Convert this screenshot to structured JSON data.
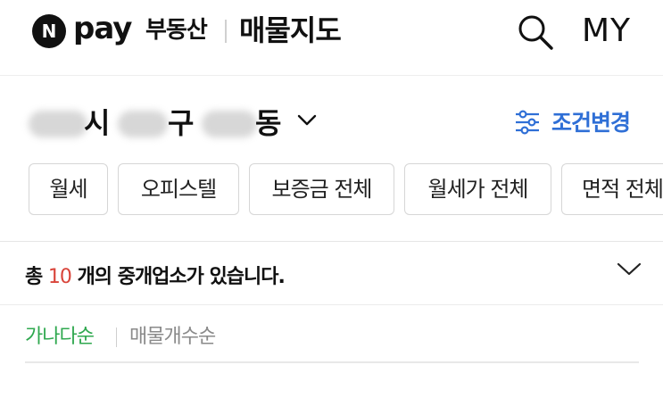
{
  "header": {
    "logo_letter": "N",
    "brand_pay": "pay",
    "brand_sub": "부동산",
    "page_title": "매물지도",
    "my_label": "MY",
    "icons": {
      "search": "search-icon",
      "logo": "naver-n-logo-icon"
    }
  },
  "location": {
    "city_suffix": "시",
    "district_suffix": "구",
    "dong_suffix": "동",
    "chevron_icon": "chevron-down-icon"
  },
  "filter": {
    "label": "조건변경",
    "icon": "sliders-icon",
    "accent": "#2f6fd6"
  },
  "chips": [
    {
      "label": "월세"
    },
    {
      "label": "오피스텔"
    },
    {
      "label": "보증금 전체"
    },
    {
      "label": "월세가 전체"
    },
    {
      "label": "면적 전체"
    }
  ],
  "summary": {
    "prefix": "총 ",
    "count": "10",
    "suffix": " 개의 중개업소가 있습니다.",
    "count_color": "#d9443a"
  },
  "sort": {
    "option_a": "가나다순",
    "option_b": "매물개수순",
    "active_color": "#2fa84f",
    "inactive_color": "#8a8a8a"
  }
}
